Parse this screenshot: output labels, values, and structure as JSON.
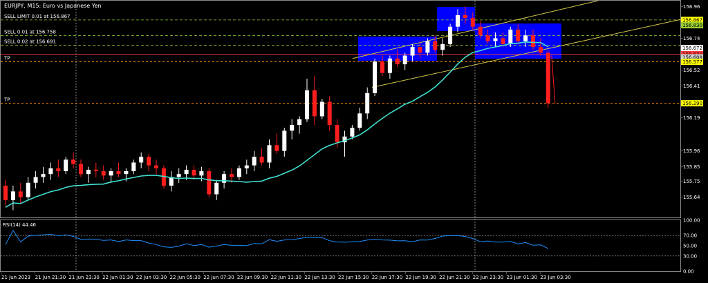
{
  "window": {
    "title": "EURJPY, M15:  Euro vs Japanese Yen"
  },
  "orders": [
    {
      "label": "SELL LIMIT 0.01 at 156.867",
      "price": 156.867,
      "color": "#9acd32"
    },
    {
      "label": "SELL 0.01 at 156.758",
      "price": 156.758,
      "color": "#9acd32"
    },
    {
      "label": "SELL 0.02 at 156.691",
      "price": 156.691,
      "color": "#9acd32"
    }
  ],
  "tp_lines": [
    {
      "label": "TP",
      "price": 156.577,
      "color": "#ff8c00"
    },
    {
      "label": "TP",
      "price": 156.29,
      "color": "#ff8c00"
    }
  ],
  "price_tags": [
    {
      "text": "156.867",
      "price": 156.867,
      "bg": "#ffff00",
      "fg": "#000000"
    },
    {
      "text": "156.830",
      "price": 156.83,
      "bg": "#9acd32",
      "fg": "#000000"
    },
    {
      "text": "156.672",
      "price": 156.672,
      "bg": "#ffffff",
      "fg": "#000000"
    },
    {
      "text": "156.630",
      "price": 156.63,
      "bg": "#ff3b3b",
      "fg": "#000000"
    },
    {
      "text": "156.608",
      "price": 156.608,
      "bg": "#d0d0d0",
      "fg": "#000000"
    },
    {
      "text": "156.577",
      "price": 156.577,
      "bg": "#ffff00",
      "fg": "#000000"
    },
    {
      "text": "156.290",
      "price": 156.29,
      "bg": "#ffff00",
      "fg": "#000000"
    }
  ],
  "rsi": {
    "label": "RSI(14) 44.46",
    "value": 44.46,
    "levels": [
      30,
      70
    ]
  },
  "colors": {
    "background": "#000000",
    "bull_candle": "#ffffff",
    "bear_candle": "#ff1e1e",
    "ma_line": "#40e0d0",
    "channel": "#d4c84a",
    "zones": "#0000ff",
    "rsi_line": "#1e90ff",
    "grid": "#555555",
    "axis_text": "#ffffff"
  },
  "chart_data": {
    "type": "candlestick",
    "symbol": "EURJPY",
    "timeframe": "M15",
    "ylim": [
      155.5,
      157.0
    ],
    "yticks": [
      156.96,
      156.74,
      156.52,
      156.41,
      156.19,
      155.96,
      155.85,
      155.75,
      155.64
    ],
    "xticks": [
      "21 Jun 2023",
      "21 Jun 21:30",
      "21 Jun 23:30",
      "22 Jun 01:30",
      "22 Jun 03:30",
      "22 Jun 05:30",
      "22 Jun 07:30",
      "22 Jun 09:30",
      "22 Jun 11:30",
      "22 Jun 13:30",
      "22 Jun 15:30",
      "22 Jun 17:30",
      "22 Jun 19:30",
      "22 Jun 21:30",
      "22 Jun 23:30",
      "23 Jun 01:30",
      "23 Jun 03:30"
    ],
    "candles": [
      {
        "o": 155.72,
        "h": 155.76,
        "l": 155.58,
        "c": 155.62
      },
      {
        "o": 155.62,
        "h": 155.72,
        "l": 155.55,
        "c": 155.68
      },
      {
        "o": 155.68,
        "h": 155.74,
        "l": 155.6,
        "c": 155.64
      },
      {
        "o": 155.64,
        "h": 155.78,
        "l": 155.62,
        "c": 155.74
      },
      {
        "o": 155.74,
        "h": 155.82,
        "l": 155.7,
        "c": 155.78
      },
      {
        "o": 155.78,
        "h": 155.85,
        "l": 155.74,
        "c": 155.8
      },
      {
        "o": 155.8,
        "h": 155.88,
        "l": 155.76,
        "c": 155.84
      },
      {
        "o": 155.84,
        "h": 155.9,
        "l": 155.78,
        "c": 155.82
      },
      {
        "o": 155.82,
        "h": 155.92,
        "l": 155.8,
        "c": 155.9
      },
      {
        "o": 155.9,
        "h": 155.95,
        "l": 155.84,
        "c": 155.87
      },
      {
        "o": 155.87,
        "h": 155.9,
        "l": 155.78,
        "c": 155.8
      },
      {
        "o": 155.8,
        "h": 155.85,
        "l": 155.74,
        "c": 155.83
      },
      {
        "o": 155.83,
        "h": 155.88,
        "l": 155.78,
        "c": 155.82
      },
      {
        "o": 155.82,
        "h": 155.86,
        "l": 155.76,
        "c": 155.79
      },
      {
        "o": 155.79,
        "h": 155.84,
        "l": 155.74,
        "c": 155.82
      },
      {
        "o": 155.82,
        "h": 155.88,
        "l": 155.78,
        "c": 155.8
      },
      {
        "o": 155.8,
        "h": 155.84,
        "l": 155.75,
        "c": 155.82
      },
      {
        "o": 155.82,
        "h": 155.9,
        "l": 155.8,
        "c": 155.88
      },
      {
        "o": 155.88,
        "h": 155.95,
        "l": 155.84,
        "c": 155.92
      },
      {
        "o": 155.92,
        "h": 155.94,
        "l": 155.82,
        "c": 155.86
      },
      {
        "o": 155.86,
        "h": 155.9,
        "l": 155.8,
        "c": 155.84
      },
      {
        "o": 155.84,
        "h": 155.86,
        "l": 155.7,
        "c": 155.72
      },
      {
        "o": 155.72,
        "h": 155.82,
        "l": 155.68,
        "c": 155.78
      },
      {
        "o": 155.78,
        "h": 155.84,
        "l": 155.74,
        "c": 155.8
      },
      {
        "o": 155.8,
        "h": 155.86,
        "l": 155.76,
        "c": 155.83
      },
      {
        "o": 155.83,
        "h": 155.86,
        "l": 155.76,
        "c": 155.79
      },
      {
        "o": 155.79,
        "h": 155.85,
        "l": 155.75,
        "c": 155.82
      },
      {
        "o": 155.82,
        "h": 155.84,
        "l": 155.64,
        "c": 155.66
      },
      {
        "o": 155.66,
        "h": 155.76,
        "l": 155.62,
        "c": 155.74
      },
      {
        "o": 155.74,
        "h": 155.82,
        "l": 155.7,
        "c": 155.8
      },
      {
        "o": 155.8,
        "h": 155.84,
        "l": 155.74,
        "c": 155.78
      },
      {
        "o": 155.78,
        "h": 155.86,
        "l": 155.76,
        "c": 155.84
      },
      {
        "o": 155.84,
        "h": 155.9,
        "l": 155.8,
        "c": 155.86
      },
      {
        "o": 155.86,
        "h": 155.96,
        "l": 155.82,
        "c": 155.92
      },
      {
        "o": 155.92,
        "h": 155.98,
        "l": 155.86,
        "c": 155.88
      },
      {
        "o": 155.88,
        "h": 156.04,
        "l": 155.84,
        "c": 156.0
      },
      {
        "o": 156.0,
        "h": 156.08,
        "l": 155.94,
        "c": 155.96
      },
      {
        "o": 155.96,
        "h": 156.12,
        "l": 155.92,
        "c": 156.1
      },
      {
        "o": 156.1,
        "h": 156.18,
        "l": 156.04,
        "c": 156.14
      },
      {
        "o": 156.14,
        "h": 156.2,
        "l": 156.08,
        "c": 156.18
      },
      {
        "o": 156.18,
        "h": 156.46,
        "l": 156.16,
        "c": 156.38
      },
      {
        "o": 156.38,
        "h": 156.48,
        "l": 156.14,
        "c": 156.2
      },
      {
        "o": 156.2,
        "h": 156.32,
        "l": 156.18,
        "c": 156.3
      },
      {
        "o": 156.3,
        "h": 156.34,
        "l": 156.1,
        "c": 156.14
      },
      {
        "o": 156.14,
        "h": 156.18,
        "l": 155.98,
        "c": 156.02
      },
      {
        "o": 156.02,
        "h": 156.1,
        "l": 155.92,
        "c": 156.06
      },
      {
        "o": 156.06,
        "h": 156.14,
        "l": 156.04,
        "c": 156.12
      },
      {
        "o": 156.12,
        "h": 156.26,
        "l": 156.1,
        "c": 156.22
      },
      {
        "o": 156.22,
        "h": 156.4,
        "l": 156.18,
        "c": 156.36
      },
      {
        "o": 156.36,
        "h": 156.6,
        "l": 156.34,
        "c": 156.58
      },
      {
        "o": 156.58,
        "h": 156.62,
        "l": 156.48,
        "c": 156.5
      },
      {
        "o": 156.5,
        "h": 156.62,
        "l": 156.46,
        "c": 156.6
      },
      {
        "o": 156.6,
        "h": 156.66,
        "l": 156.54,
        "c": 156.56
      },
      {
        "o": 156.56,
        "h": 156.64,
        "l": 156.52,
        "c": 156.62
      },
      {
        "o": 156.62,
        "h": 156.7,
        "l": 156.58,
        "c": 156.68
      },
      {
        "o": 156.68,
        "h": 156.72,
        "l": 156.6,
        "c": 156.64
      },
      {
        "o": 156.64,
        "h": 156.74,
        "l": 156.62,
        "c": 156.72
      },
      {
        "o": 156.72,
        "h": 156.76,
        "l": 156.64,
        "c": 156.66
      },
      {
        "o": 156.66,
        "h": 156.74,
        "l": 156.62,
        "c": 156.7
      },
      {
        "o": 156.7,
        "h": 156.84,
        "l": 156.68,
        "c": 156.82
      },
      {
        "o": 156.82,
        "h": 156.94,
        "l": 156.78,
        "c": 156.9
      },
      {
        "o": 156.9,
        "h": 156.96,
        "l": 156.84,
        "c": 156.88
      },
      {
        "o": 156.88,
        "h": 156.92,
        "l": 156.8,
        "c": 156.82
      },
      {
        "o": 156.82,
        "h": 156.86,
        "l": 156.74,
        "c": 156.76
      },
      {
        "o": 156.76,
        "h": 156.8,
        "l": 156.7,
        "c": 156.72
      },
      {
        "o": 156.72,
        "h": 156.78,
        "l": 156.68,
        "c": 156.74
      },
      {
        "o": 156.74,
        "h": 156.78,
        "l": 156.68,
        "c": 156.7
      },
      {
        "o": 156.7,
        "h": 156.82,
        "l": 156.68,
        "c": 156.8
      },
      {
        "o": 156.8,
        "h": 156.84,
        "l": 156.7,
        "c": 156.72
      },
      {
        "o": 156.72,
        "h": 156.8,
        "l": 156.68,
        "c": 156.76
      },
      {
        "o": 156.76,
        "h": 156.8,
        "l": 156.66,
        "c": 156.68
      },
      {
        "o": 156.68,
        "h": 156.74,
        "l": 156.62,
        "c": 156.64
      },
      {
        "o": 156.64,
        "h": 156.66,
        "l": 156.26,
        "c": 156.29
      }
    ]
  }
}
